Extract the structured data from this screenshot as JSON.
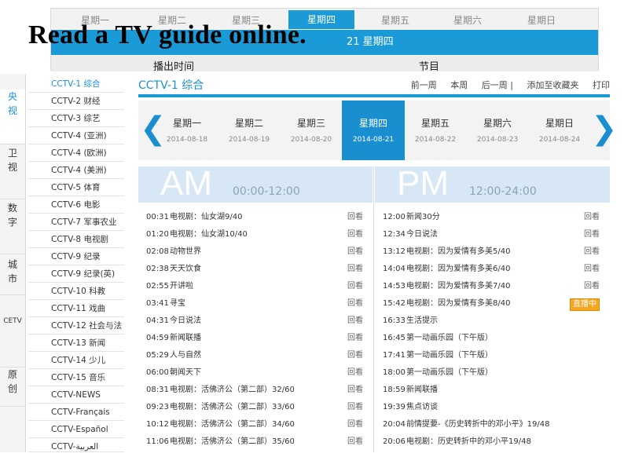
{
  "top": {
    "tabs": [
      "星期一",
      "星期二",
      "星期三",
      "星期四",
      "星期五",
      "星期六",
      "星期日"
    ],
    "active_tab": 3,
    "bar_text": "21 星期四",
    "col_time": "播出时间",
    "col_program": "节目"
  },
  "headline": "Read a TV guide online.",
  "leftnav": [
    "央视",
    "卫视",
    "数字",
    "城市",
    "CETV",
    "原创"
  ],
  "channels": [
    "CCTV-1 综合",
    "CCTV-2 财经",
    "CCTV-3 综艺",
    "CCTV-4 (亚洲)",
    "CCTV-4 (欧洲)",
    "CCTV-4 (美洲)",
    "CCTV-5 体育",
    "CCTV-6 电影",
    "CCTV-7 军事农业",
    "CCTV-8 电视剧",
    "CCTV-9 纪录",
    "CCTV-9 纪录(英)",
    "CCTV-10 科教",
    "CCTV-11 戏曲",
    "CCTV-12 社会与法",
    "CCTV-13 新闻",
    "CCTV-14 少儿",
    "CCTV-15 音乐",
    "CCTV-NEWS",
    "CCTV-Français",
    "CCTV-Español",
    "CCTV-العربية"
  ],
  "main": {
    "channel_title": "CCTV-1 综合",
    "links": [
      "前一周",
      "本周",
      "后一周 |",
      "添加至收藏夹",
      "打印"
    ],
    "prev_arrow": "❮",
    "next_arrow": "❯",
    "week": [
      {
        "name": "星期一",
        "date": "2014-08-18"
      },
      {
        "name": "星期二",
        "date": "2014-08-19"
      },
      {
        "name": "星期三",
        "date": "2014-08-20"
      },
      {
        "name": "星期四",
        "date": "2014-08-21"
      },
      {
        "name": "星期五",
        "date": "2014-08-22"
      },
      {
        "name": "星期六",
        "date": "2014-08-23"
      },
      {
        "name": "星期日",
        "date": "2014-08-24"
      }
    ],
    "active_day": 3,
    "am": {
      "label": "AM",
      "range": "00:00-12:00"
    },
    "pm": {
      "label": "PM",
      "range": "12:00-24:00"
    },
    "am_rows": [
      {
        "time": "00:31",
        "name": "电视剧：仙女湖9/40",
        "action": "回看"
      },
      {
        "time": "01:20",
        "name": "电视剧：仙女湖10/40",
        "action": "回看"
      },
      {
        "time": "02:08",
        "name": "动物世界",
        "action": "回看"
      },
      {
        "time": "02:38",
        "name": "天天饮食",
        "action": "回看"
      },
      {
        "time": "02:55",
        "name": "开讲啦",
        "action": "回看"
      },
      {
        "time": "03:41",
        "name": "寻宝",
        "action": "回看"
      },
      {
        "time": "04:31",
        "name": "今日说法",
        "action": "回看"
      },
      {
        "time": "04:59",
        "name": "新闻联播",
        "action": "回看"
      },
      {
        "time": "05:29",
        "name": "人与自然",
        "action": "回看"
      },
      {
        "time": "06:00",
        "name": "朝闻天下",
        "action": "回看"
      },
      {
        "time": "08:31",
        "name": "电视剧：活佛济公（第二部）32/60",
        "action": "回看"
      },
      {
        "time": "09:23",
        "name": "电视剧：活佛济公（第二部）33/60",
        "action": "回看"
      },
      {
        "time": "10:12",
        "name": "电视剧：活佛济公（第二部）34/60",
        "action": "回看"
      },
      {
        "time": "11:06",
        "name": "电视剧：活佛济公（第二部）35/60",
        "action": "回看"
      }
    ],
    "pm_rows": [
      {
        "time": "12:00",
        "name": "新闻30分",
        "action": "回看"
      },
      {
        "time": "12:34",
        "name": "今日说法",
        "action": "回看"
      },
      {
        "time": "13:12",
        "name": "电视剧：因为爱情有多美5/40",
        "action": "回看"
      },
      {
        "time": "14:04",
        "name": "电视剧：因为爱情有多美6/40",
        "action": "回看"
      },
      {
        "time": "14:53",
        "name": "电视剧：因为爱情有多美7/40",
        "action": "回看"
      },
      {
        "time": "15:42",
        "name": "电视剧：因为爱情有多美8/40",
        "action": "直播中"
      },
      {
        "time": "16:33",
        "name": "生活提示",
        "action": ""
      },
      {
        "time": "16:45",
        "name": "第一动画乐园（下午版）",
        "action": ""
      },
      {
        "time": "17:41",
        "name": "第一动画乐园（下午版）",
        "action": ""
      },
      {
        "time": "18:00",
        "name": "第一动画乐园（下午版）",
        "action": ""
      },
      {
        "time": "18:59",
        "name": "新闻联播",
        "action": ""
      },
      {
        "time": "19:39",
        "name": "焦点访谈",
        "action": ""
      },
      {
        "time": "20:04",
        "name": "前情提要-《历史转折中的邓小平》19/48",
        "action": ""
      },
      {
        "time": "20:06",
        "name": "电视剧：历史转折中的邓小平19/48",
        "action": ""
      }
    ]
  }
}
